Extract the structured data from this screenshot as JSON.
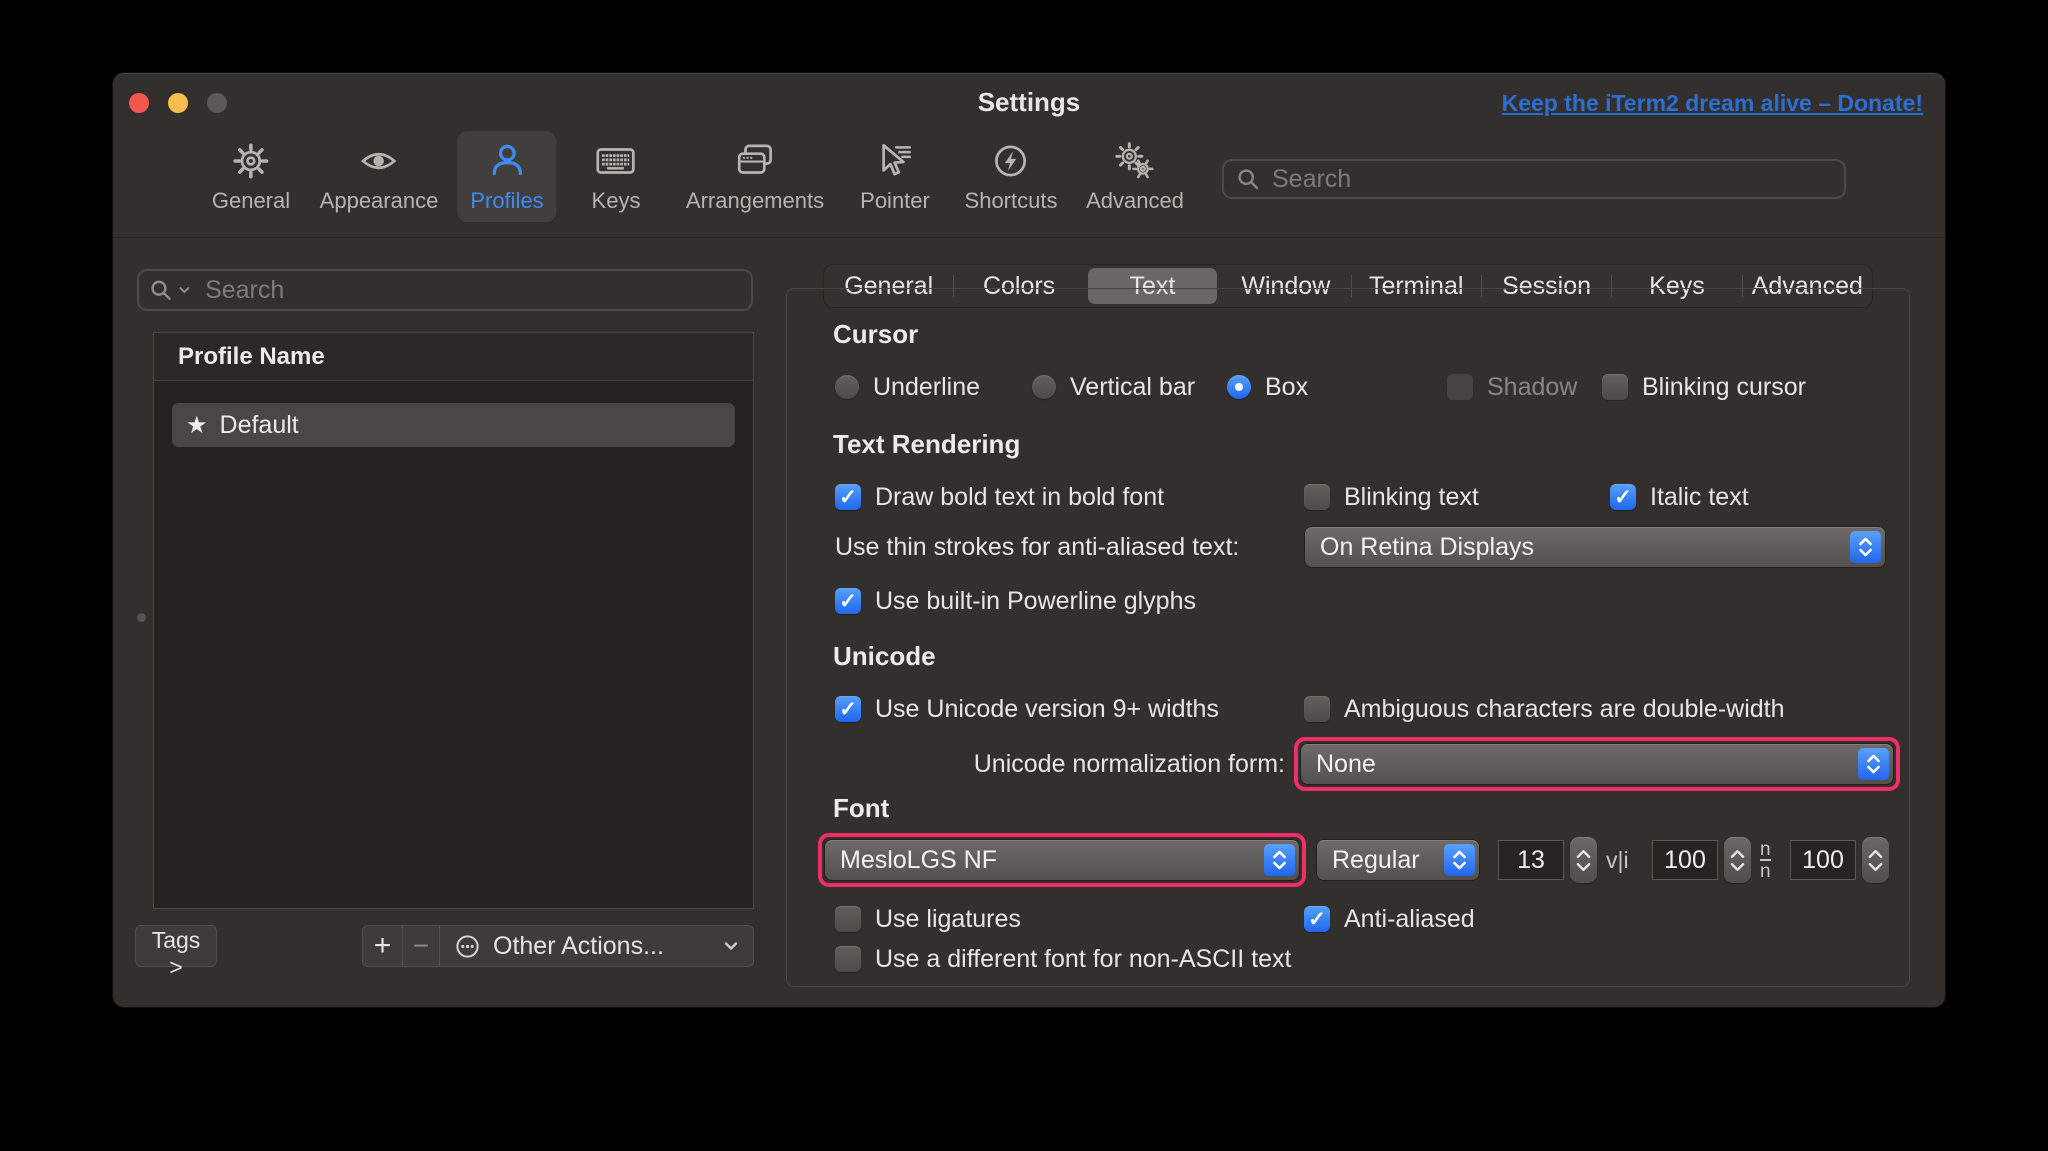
{
  "window": {
    "title": "Settings",
    "donate_link": "Keep the iTerm2 dream alive – Donate!"
  },
  "toolbar": {
    "search_placeholder": "Search",
    "selected_item": "Profiles",
    "items": [
      {
        "label": "General",
        "icon": "gear-icon"
      },
      {
        "label": "Appearance",
        "icon": "eye-icon"
      },
      {
        "label": "Profiles",
        "icon": "person-icon"
      },
      {
        "label": "Keys",
        "icon": "keyboard-icon"
      },
      {
        "label": "Arrangements",
        "icon": "windows-icon"
      },
      {
        "label": "Pointer",
        "icon": "cursor-icon"
      },
      {
        "label": "Shortcuts",
        "icon": "lightning-icon"
      },
      {
        "label": "Advanced",
        "icon": "gears-icon"
      }
    ]
  },
  "sidebar": {
    "search_placeholder": "Search",
    "column_header": "Profile Name",
    "rows": [
      {
        "name": "Default",
        "starred": true,
        "selected": true
      }
    ],
    "tags_button": "Tags >",
    "add_button": "+",
    "remove_button": "−",
    "other_actions_label": "Other Actions..."
  },
  "tabs": {
    "selected": "Text",
    "items": [
      {
        "label": "General"
      },
      {
        "label": "Colors"
      },
      {
        "label": "Text"
      },
      {
        "label": "Window"
      },
      {
        "label": "Terminal"
      },
      {
        "label": "Session"
      },
      {
        "label": "Keys"
      },
      {
        "label": "Advanced"
      }
    ]
  },
  "cursor": {
    "heading": "Cursor",
    "underline": "Underline",
    "vertical_bar": "Vertical bar",
    "box": "Box",
    "shadow": "Shadow",
    "blinking_cursor": "Blinking cursor"
  },
  "text_rendering": {
    "heading": "Text Rendering",
    "draw_bold": "Draw bold text in bold font",
    "blinking_text": "Blinking text",
    "italic_text": "Italic text",
    "thin_strokes_label": "Use thin strokes for anti-aliased text:",
    "thin_strokes_value": "On Retina Displays",
    "powerline": "Use built-in Powerline glyphs"
  },
  "unicode": {
    "heading": "Unicode",
    "v9": "Use Unicode version 9+ widths",
    "ambiguous": "Ambiguous characters are double-width",
    "normalization_label": "Unicode normalization form:",
    "normalization_value": "None"
  },
  "font": {
    "heading": "Font",
    "family": "MesloLGS NF",
    "style": "Regular",
    "size": "13",
    "h_spacing_icon": "v|i",
    "h_spacing": "100",
    "v_spacing_icon_top": "n",
    "v_spacing_icon_bottom": "n",
    "v_spacing": "100",
    "ligatures": "Use ligatures",
    "antialiased": "Anti-aliased",
    "non_ascii": "Use a different font for non-ASCII text"
  },
  "states": {
    "cursor_shape": "Box",
    "shadow": {
      "checked": false,
      "disabled": true
    },
    "blinking_cursor": false,
    "draw_bold": true,
    "blinking_text": false,
    "italic_text": true,
    "powerline": true,
    "unicode_v9": true,
    "ambiguous_double_width": false,
    "use_ligatures": false,
    "antialiased": true,
    "non_ascii_font": false,
    "highlighted_controls": [
      "unicode-normalization-popup",
      "font-family-popup"
    ]
  },
  "colors": {
    "accent_blue": "#3478f6",
    "highlight_pink": "#ee2f67",
    "link_blue": "#2b6fd3",
    "profiles_blue": "#3f8af5"
  }
}
